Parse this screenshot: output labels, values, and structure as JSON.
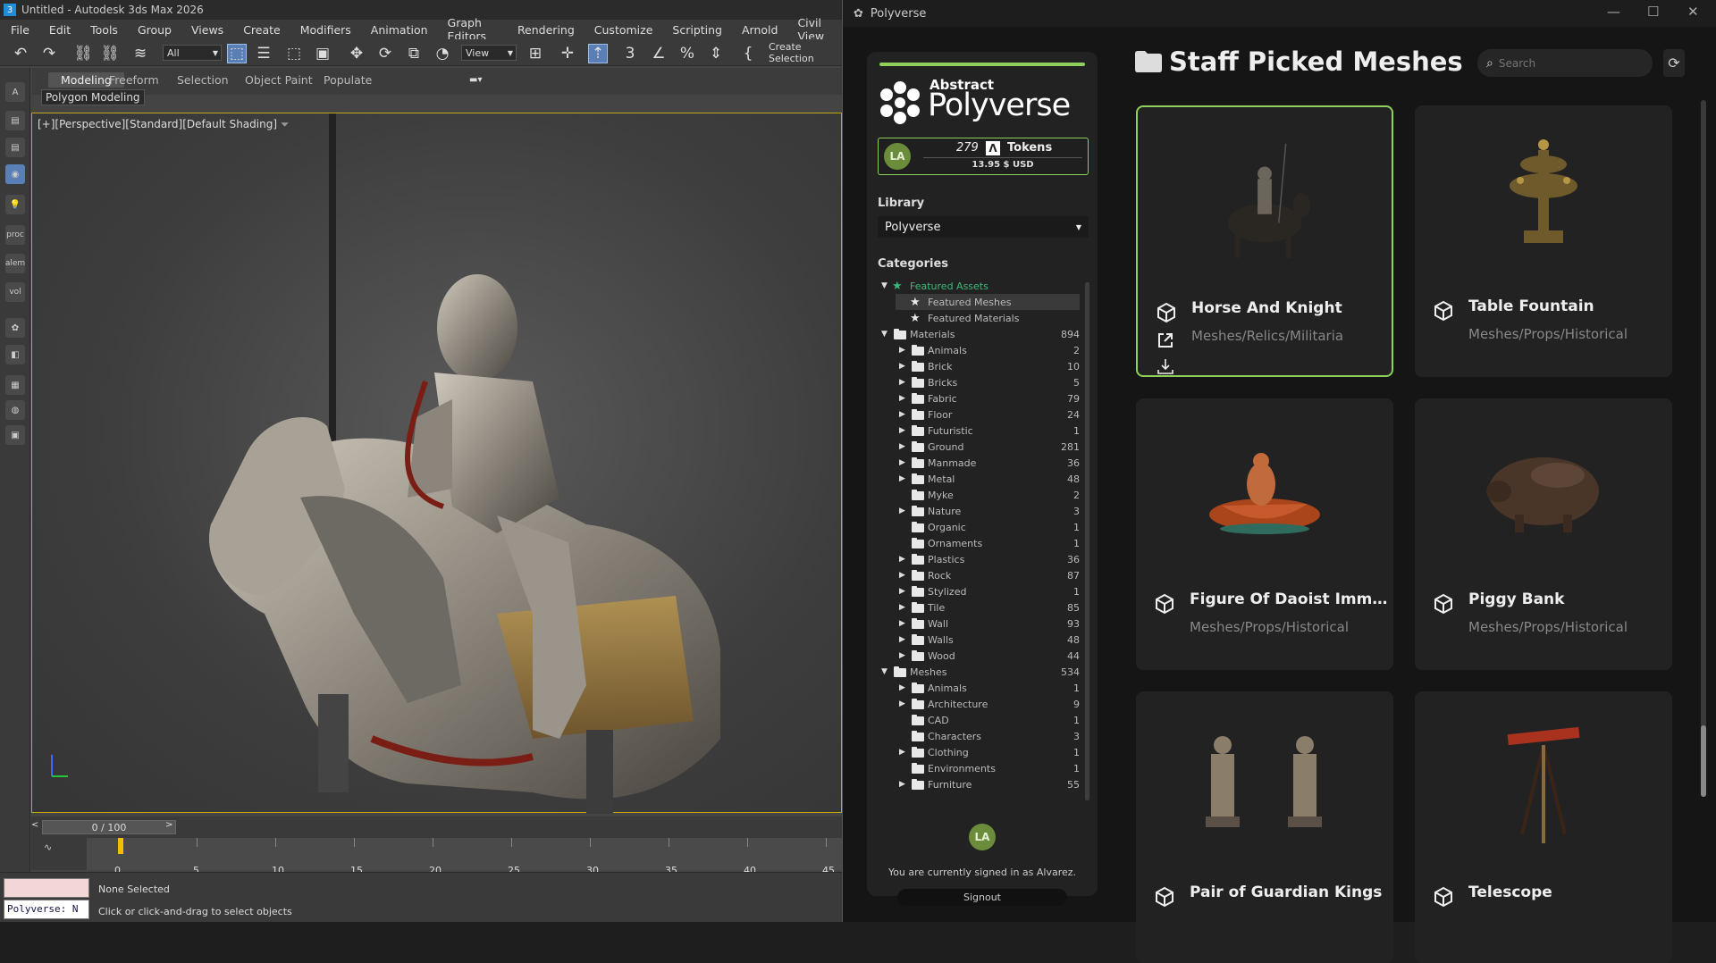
{
  "max": {
    "title": "Untitled - Autodesk 3ds Max 2026",
    "menu": [
      "File",
      "Edit",
      "Tools",
      "Group",
      "Views",
      "Create",
      "Modifiers",
      "Animation",
      "Graph Editors",
      "Rendering",
      "Customize",
      "Scripting",
      "Arnold",
      "Civil View"
    ],
    "toolbar": {
      "filter_value": "All",
      "view_value": "View",
      "create_selection": "Create Selection"
    },
    "ribbon_tabs": [
      "Modeling",
      "Freeform",
      "Selection",
      "Object Paint",
      "Populate"
    ],
    "ribbon_sub": "Polygon Modeling",
    "leftbar_labels": [
      "proc",
      "alem",
      "vol"
    ],
    "viewport_label": "[+][Perspective][Standard][Default Shading]",
    "frame_counter": "0 / 100",
    "timeline_ticks": [
      "0",
      "5",
      "10",
      "15",
      "20",
      "25",
      "30",
      "35",
      "40",
      "45"
    ],
    "status": {
      "selection": "None Selected",
      "hint": "Click or click-and-drag to select objects",
      "script": "Polyverse: N"
    }
  },
  "pv": {
    "window_title": "Polyverse",
    "logo_small": "Abstract",
    "logo_big": "Polyverse",
    "user_initials": "LA",
    "tokens_value": "279",
    "tokens_label": "Tokens",
    "tokens_usd": "13.95 $ USD",
    "library_title": "Library",
    "library_value": "Polyverse",
    "categories_title": "Categories",
    "tree": [
      {
        "label": "Featured Assets",
        "level": 0,
        "toggle": "▼",
        "icon": "star",
        "count": "",
        "color": "#3eb87a"
      },
      {
        "label": "Featured Meshes",
        "level": 1,
        "toggle": "",
        "icon": "star",
        "count": "",
        "hl": true
      },
      {
        "label": "Featured Materials",
        "level": 1,
        "toggle": "",
        "icon": "star",
        "count": ""
      },
      {
        "label": "Materials",
        "level": 0,
        "toggle": "▼",
        "icon": "folder",
        "count": "894"
      },
      {
        "label": "Animals",
        "level": 1,
        "toggle": "▶",
        "icon": "folder",
        "count": "2"
      },
      {
        "label": "Brick",
        "level": 1,
        "toggle": "▶",
        "icon": "folder",
        "count": "10"
      },
      {
        "label": "Bricks",
        "level": 1,
        "toggle": "▶",
        "icon": "folder",
        "count": "5"
      },
      {
        "label": "Fabric",
        "level": 1,
        "toggle": "▶",
        "icon": "folder",
        "count": "79"
      },
      {
        "label": "Floor",
        "level": 1,
        "toggle": "▶",
        "icon": "folder",
        "count": "24"
      },
      {
        "label": "Futuristic",
        "level": 1,
        "toggle": "▶",
        "icon": "folder",
        "count": "1"
      },
      {
        "label": "Ground",
        "level": 1,
        "toggle": "▶",
        "icon": "folder",
        "count": "281"
      },
      {
        "label": "Manmade",
        "level": 1,
        "toggle": "▶",
        "icon": "folder",
        "count": "36"
      },
      {
        "label": "Metal",
        "level": 1,
        "toggle": "▶",
        "icon": "folder",
        "count": "48"
      },
      {
        "label": "Myke",
        "level": 1,
        "toggle": "",
        "icon": "folder",
        "count": "2"
      },
      {
        "label": "Nature",
        "level": 1,
        "toggle": "▶",
        "icon": "folder",
        "count": "3"
      },
      {
        "label": "Organic",
        "level": 1,
        "toggle": "",
        "icon": "folder",
        "count": "1"
      },
      {
        "label": "Ornaments",
        "level": 1,
        "toggle": "",
        "icon": "folder",
        "count": "1"
      },
      {
        "label": "Plastics",
        "level": 1,
        "toggle": "▶",
        "icon": "folder",
        "count": "36"
      },
      {
        "label": "Rock",
        "level": 1,
        "toggle": "▶",
        "icon": "folder",
        "count": "87"
      },
      {
        "label": "Stylized",
        "level": 1,
        "toggle": "▶",
        "icon": "folder",
        "count": "1"
      },
      {
        "label": "Tile",
        "level": 1,
        "toggle": "▶",
        "icon": "folder",
        "count": "85"
      },
      {
        "label": "Wall",
        "level": 1,
        "toggle": "▶",
        "icon": "folder",
        "count": "93"
      },
      {
        "label": "Walls",
        "level": 1,
        "toggle": "▶",
        "icon": "folder",
        "count": "48"
      },
      {
        "label": "Wood",
        "level": 1,
        "toggle": "▶",
        "icon": "folder",
        "count": "44"
      },
      {
        "label": "Meshes",
        "level": 0,
        "toggle": "▼",
        "icon": "folder",
        "count": "534"
      },
      {
        "label": "Animals",
        "level": 1,
        "toggle": "▶",
        "icon": "folder",
        "count": "1"
      },
      {
        "label": "Architecture",
        "level": 1,
        "toggle": "▶",
        "icon": "folder",
        "count": "9"
      },
      {
        "label": "CAD",
        "level": 1,
        "toggle": "",
        "icon": "folder",
        "count": "1"
      },
      {
        "label": "Characters",
        "level": 1,
        "toggle": "",
        "icon": "folder",
        "count": "3"
      },
      {
        "label": "Clothing",
        "level": 1,
        "toggle": "▶",
        "icon": "folder",
        "count": "1"
      },
      {
        "label": "Environments",
        "level": 1,
        "toggle": "",
        "icon": "folder",
        "count": "1"
      },
      {
        "label": "Furniture",
        "level": 1,
        "toggle": "▶",
        "icon": "folder",
        "count": "55"
      }
    ],
    "signed_in_text": "You are currently signed in as Alvarez.",
    "signout_label": "Signout",
    "main_title": "Staff Picked Meshes",
    "search_placeholder": "Search",
    "cards": [
      {
        "title": "Horse And Knight",
        "path": "Meshes/Relics/Militaria",
        "selected": true,
        "thumb": "knight"
      },
      {
        "title": "Table Fountain",
        "path": "Meshes/Props/Historical",
        "selected": false,
        "thumb": "fountain"
      },
      {
        "title": "Figure Of Daoist Immorta...",
        "path": "Meshes/Props/Historical",
        "selected": false,
        "thumb": "daoist"
      },
      {
        "title": "Piggy Bank",
        "path": "Meshes/Props/Historical",
        "selected": false,
        "thumb": "piggy"
      },
      {
        "title": "Pair of Guardian Kings",
        "path": "",
        "selected": false,
        "thumb": "guardians"
      },
      {
        "title": "Telescope",
        "path": "",
        "selected": false,
        "thumb": "telescope"
      }
    ],
    "colors": {
      "accent": "#8ed05a",
      "featured": "#3eb87a",
      "avatar": "#6b8d3b"
    }
  }
}
